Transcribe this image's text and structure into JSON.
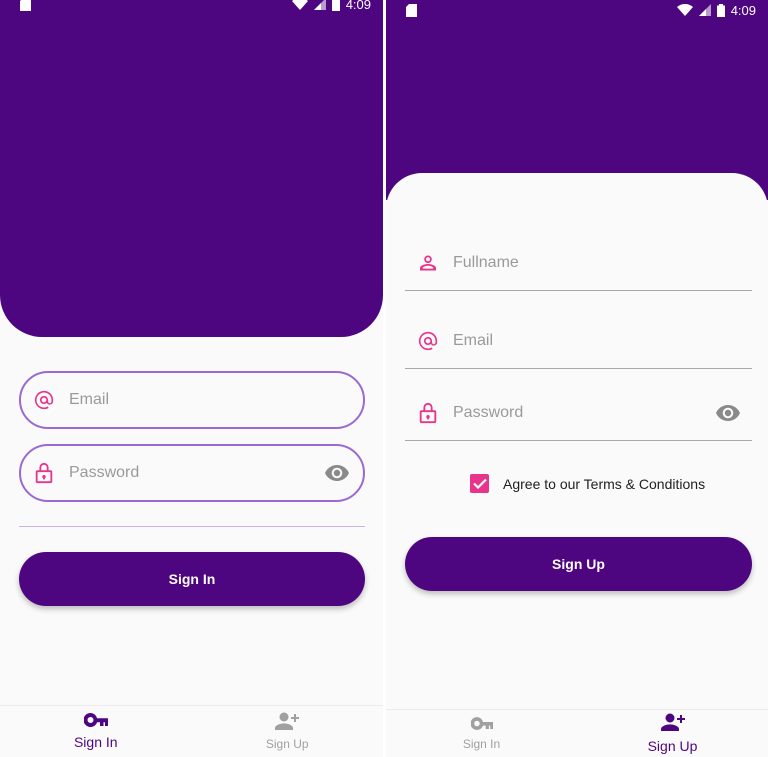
{
  "colors": {
    "primary": "#4e0680",
    "accent_pink": "#e8348a",
    "field_border": "#9a6ad2",
    "inactive": "#a0a0a0"
  },
  "status_bar": {
    "time": "4:09"
  },
  "sign_in_screen": {
    "email": {
      "placeholder": "Email",
      "value": "",
      "icon": "at-icon"
    },
    "password": {
      "placeholder": "Password",
      "value": "",
      "icon": "lock-icon",
      "toggle_icon": "eye-icon"
    },
    "submit_label": "Sign In",
    "nav": [
      {
        "label": "Sign In",
        "icon": "key-icon",
        "active": true
      },
      {
        "label": "Sign Up",
        "icon": "person-add-icon",
        "active": false
      }
    ]
  },
  "sign_up_screen": {
    "fullname": {
      "placeholder": "Fullname",
      "value": "",
      "icon": "person-icon"
    },
    "email": {
      "placeholder": "Email",
      "value": "",
      "icon": "at-icon"
    },
    "password": {
      "placeholder": "Password",
      "value": "",
      "icon": "lock-icon",
      "toggle_icon": "eye-icon"
    },
    "terms": {
      "label": "Agree to our Terms & Conditions",
      "checked": true
    },
    "submit_label": "Sign Up",
    "nav": [
      {
        "label": "Sign In",
        "icon": "key-icon",
        "active": false
      },
      {
        "label": "Sign Up",
        "icon": "person-add-icon",
        "active": true
      }
    ]
  }
}
